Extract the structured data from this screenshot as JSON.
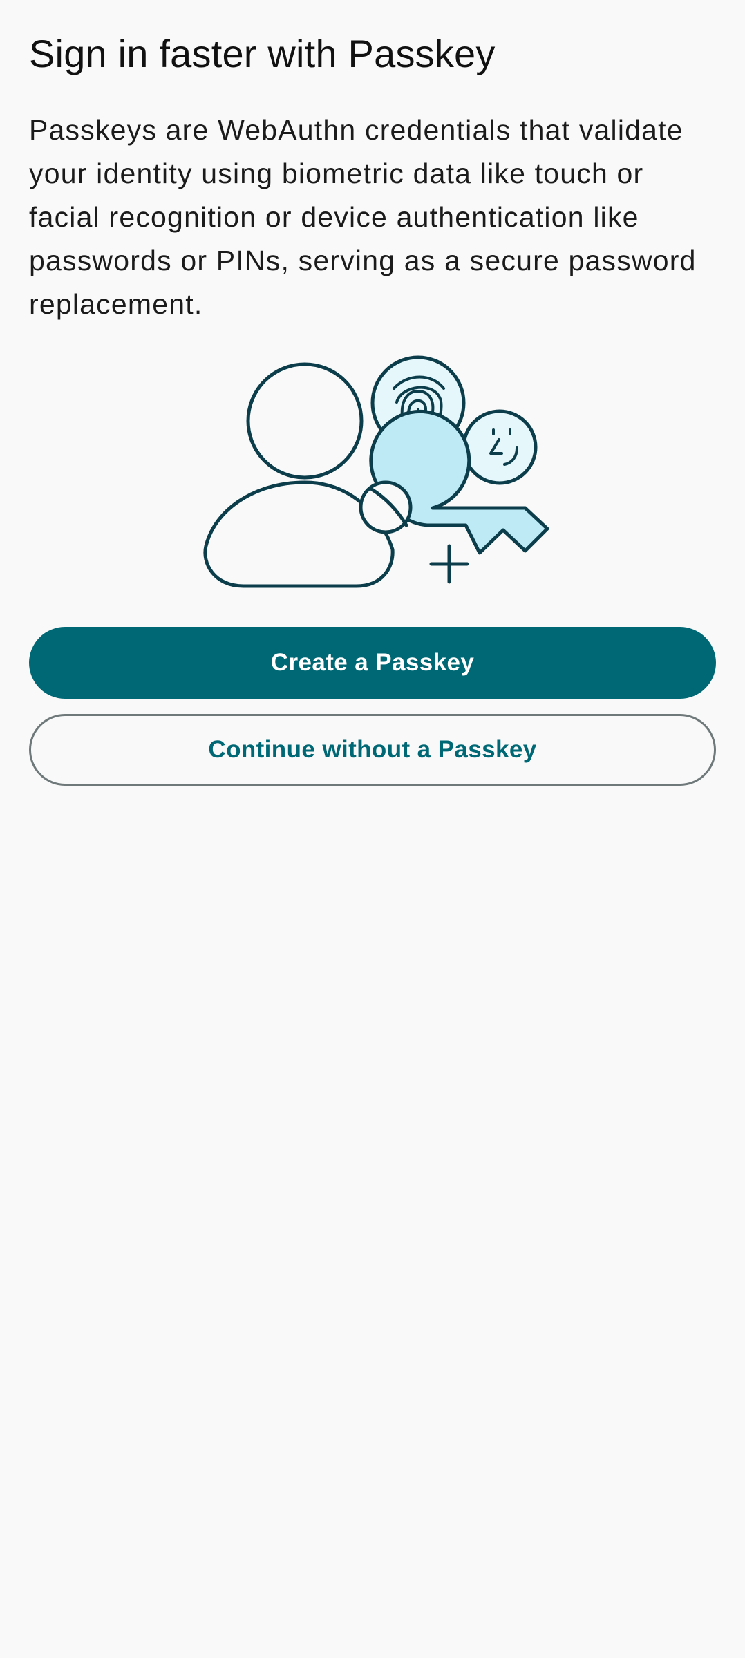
{
  "header": {
    "title": "Sign in faster with Passkey"
  },
  "main": {
    "description": "Passkeys are WebAuthn credentials that validate your identity using biometric data like touch or facial recognition or device authentication like passwords or PINs, serving as a secure password replacement.",
    "illustration": {
      "icon": "passkey-illustration-icon"
    }
  },
  "actions": {
    "create_label": "Create a Passkey",
    "skip_label": "Continue without a Passkey"
  },
  "colors": {
    "primary": "#006874",
    "outline": "#6f797a",
    "illustration_stroke": "#0b3d4a",
    "illustration_fill": "#bdeaf5",
    "illustration_light_fill": "#e6f7fb",
    "background": "#f9f9f9"
  }
}
